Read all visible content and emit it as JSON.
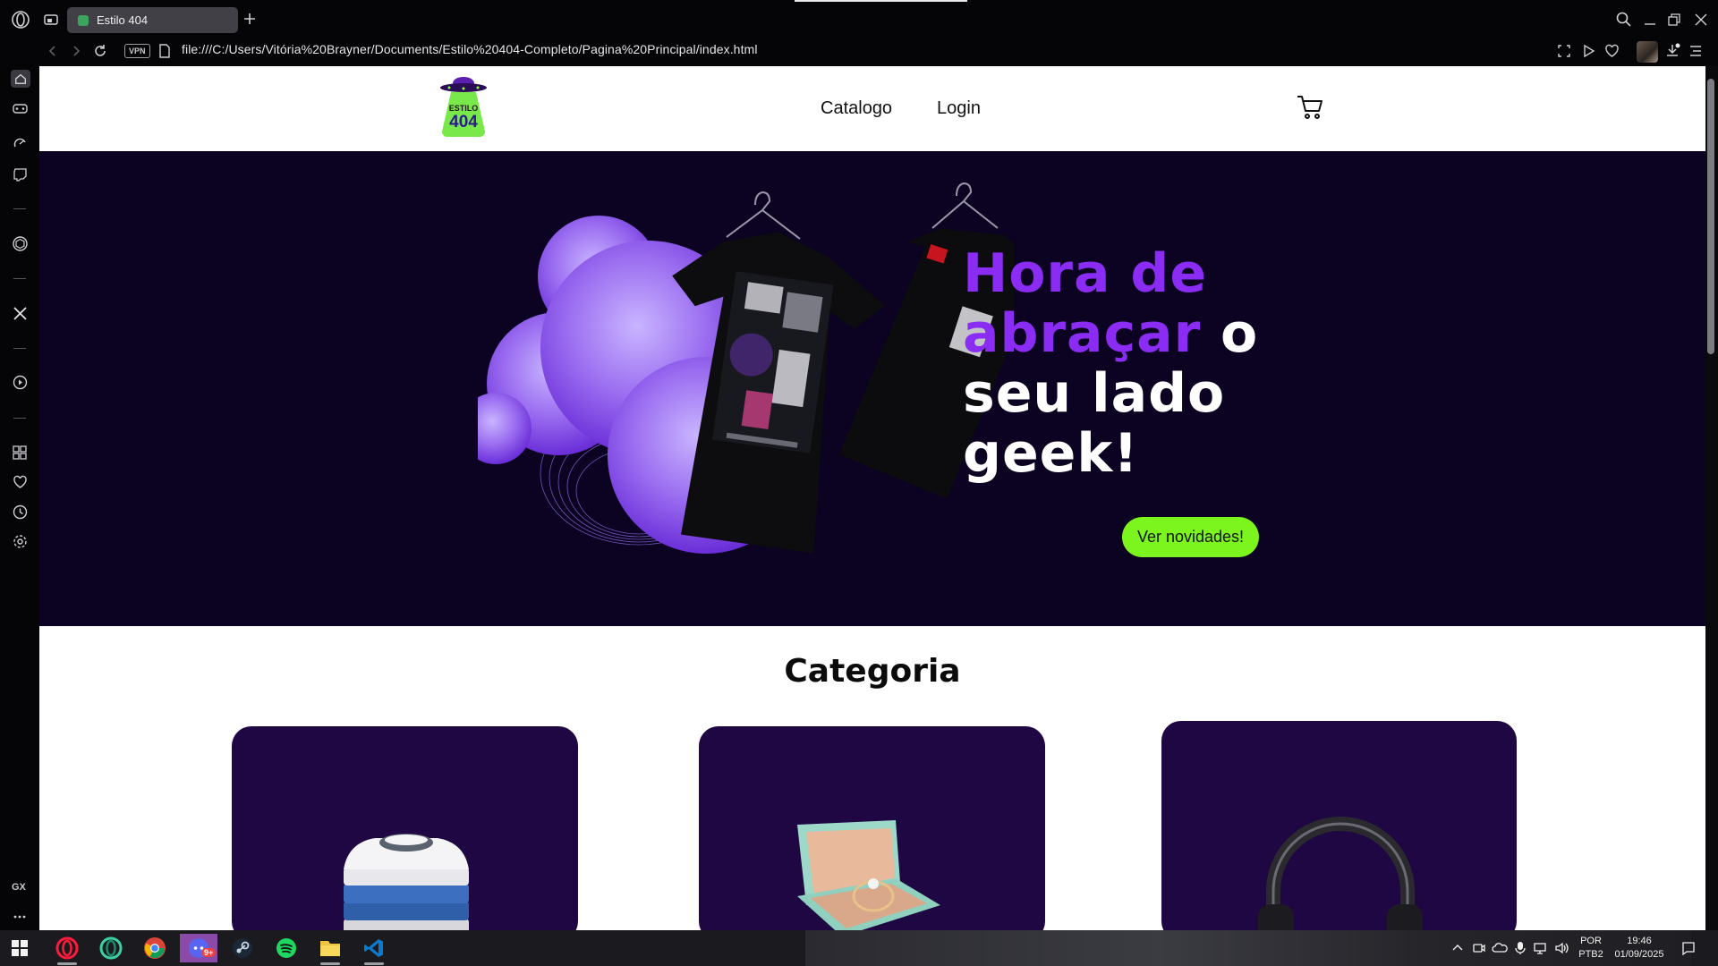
{
  "browser": {
    "tab_title": "Estilo 404",
    "url": "file:///C:/Users/Vitória%20Brayner/Documents/Estilo%20404-Completo/Pagina%20Principal/index.html",
    "vpn_label": "VPN",
    "gx_label": "GX"
  },
  "site": {
    "logo_text_top": "ESTILO",
    "logo_text_bottom": "404",
    "nav": [
      "Catalogo",
      "Login"
    ],
    "hero": {
      "title_accent": "Hora de abraçar",
      "title_rest": " o seu lado geek!",
      "cta_label": "Ver novidades!"
    },
    "category_title": "Categoria",
    "categories": [
      {
        "icon": "folded-shirts-image"
      },
      {
        "icon": "ring-box-image"
      },
      {
        "icon": "headphones-image"
      }
    ]
  },
  "taskbar": {
    "lang_top": "POR",
    "lang_bottom": "PTB2",
    "time": "19:46",
    "date": "01/09/2025",
    "discord_badge": "9+"
  },
  "colors": {
    "hero_bg": "#0b0321",
    "accent_purple": "#8b2cf5",
    "cta_green": "#7cf51e",
    "card_bg": "#1e0742"
  }
}
